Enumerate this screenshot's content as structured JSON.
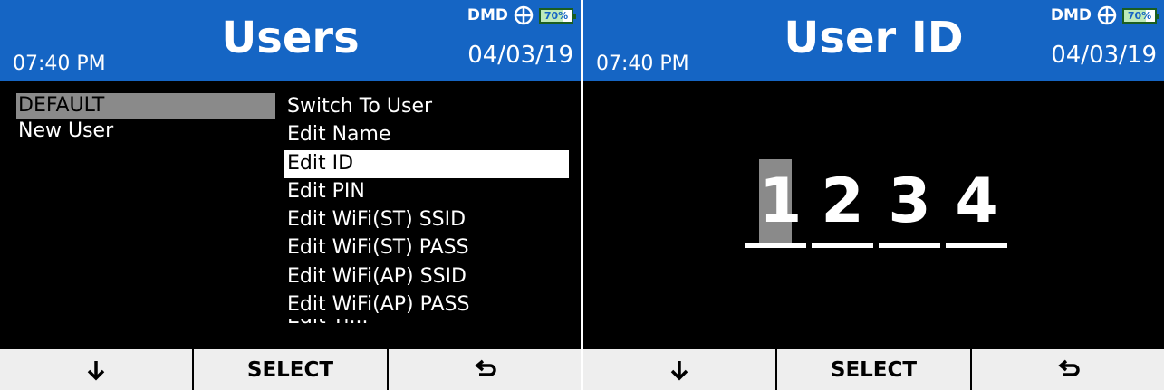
{
  "colors": {
    "header_bg": "#1565c4",
    "screen_bg": "#000000",
    "highlight": "#8a8a8a",
    "softkey_bg": "#eeeeee"
  },
  "status": {
    "brand": "DMD",
    "battery": "70%",
    "battery_level": 0.7
  },
  "screen1": {
    "time": "07:40 PM",
    "title": "Users",
    "date": "04/03/19",
    "users": [
      "DEFAULT",
      "New User"
    ],
    "menu": [
      "Switch To User",
      "Edit Name",
      "Edit ID",
      "Edit PIN",
      "Edit WiFi(ST) SSID",
      "Edit WiFi(ST) PASS",
      "Edit WiFi(AP) SSID",
      "Edit WiFi(AP) PASS",
      "Edit Ti..."
    ],
    "softkeys": {
      "down_icon": "down-arrow-icon",
      "select": "SELECT",
      "back_icon": "back-arrow-icon"
    }
  },
  "screen2": {
    "time": "07:40 PM",
    "title": "User ID",
    "date": "04/03/19",
    "digits": [
      "1",
      "2",
      "3",
      "4"
    ],
    "softkeys": {
      "down_icon": "down-arrow-icon",
      "select": "SELECT",
      "back_icon": "back-arrow-icon"
    }
  }
}
